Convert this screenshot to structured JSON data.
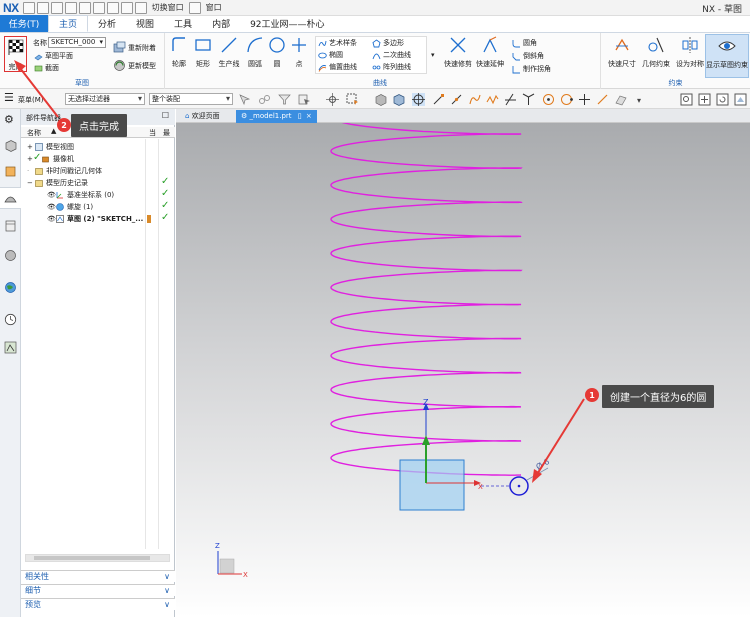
{
  "titlebar": {
    "app_logo": "NX",
    "switch_window": "切换窗口",
    "window_menu": "窗口",
    "title": "NX - 草图"
  },
  "menu": {
    "task": "任务(T)",
    "tabs": [
      "主页",
      "分析",
      "视图",
      "工具",
      "内部",
      "92工业网——朴心"
    ]
  },
  "ribbon": {
    "finish": "完成",
    "name_label": "名称",
    "sketch_name": "SKETCH_000",
    "sketch_plane": "草图平面",
    "section": "截面",
    "reattach": "重新附着",
    "update_model": "更新模型",
    "curve_tools": [
      "轮廓",
      "矩形",
      "生产线",
      "圆弧",
      "圆",
      "点"
    ],
    "spline_items": [
      "艺术样条",
      "椭圆",
      "偏置曲线"
    ],
    "poly_items": [
      "多边形",
      "二次曲线",
      "阵列曲线"
    ],
    "trim": "快速修剪",
    "extend": "快速延伸",
    "corner_items": [
      "圆角",
      "倒斜角",
      "制作拐角"
    ],
    "constraint_items": [
      "快速尺寸",
      "几何约束",
      "设为对称",
      "显示草图约束"
    ],
    "group_labels": [
      "草图",
      "曲线",
      "约束"
    ]
  },
  "selection_bar": {
    "menu": "菜单(M)",
    "filter": "无选择过滤器",
    "assembly": "整个装配"
  },
  "navigator": {
    "title": "部件导航器",
    "col_name": "名称",
    "col_current": "当",
    "col_latest": "最",
    "tree": [
      "模型视图",
      "摄像机",
      "非时间戳记几何体",
      "模型历史记录",
      "基准坐标系 (0)",
      "螺旋 (1)",
      "草图 (2) \"SKETCH_..."
    ],
    "bottom_panels": [
      "相关性",
      "细节",
      "预览"
    ]
  },
  "viewport": {
    "tabs": [
      "欢迎页面",
      "_model1.prt"
    ],
    "axis_z": "Z",
    "axis_x": "X",
    "dim_label": "Ø 6"
  },
  "annotations": {
    "step1_num": "1",
    "step1_text": "创建一个直径为6的圆",
    "step2_num": "2",
    "step2_text": "点击完成"
  }
}
